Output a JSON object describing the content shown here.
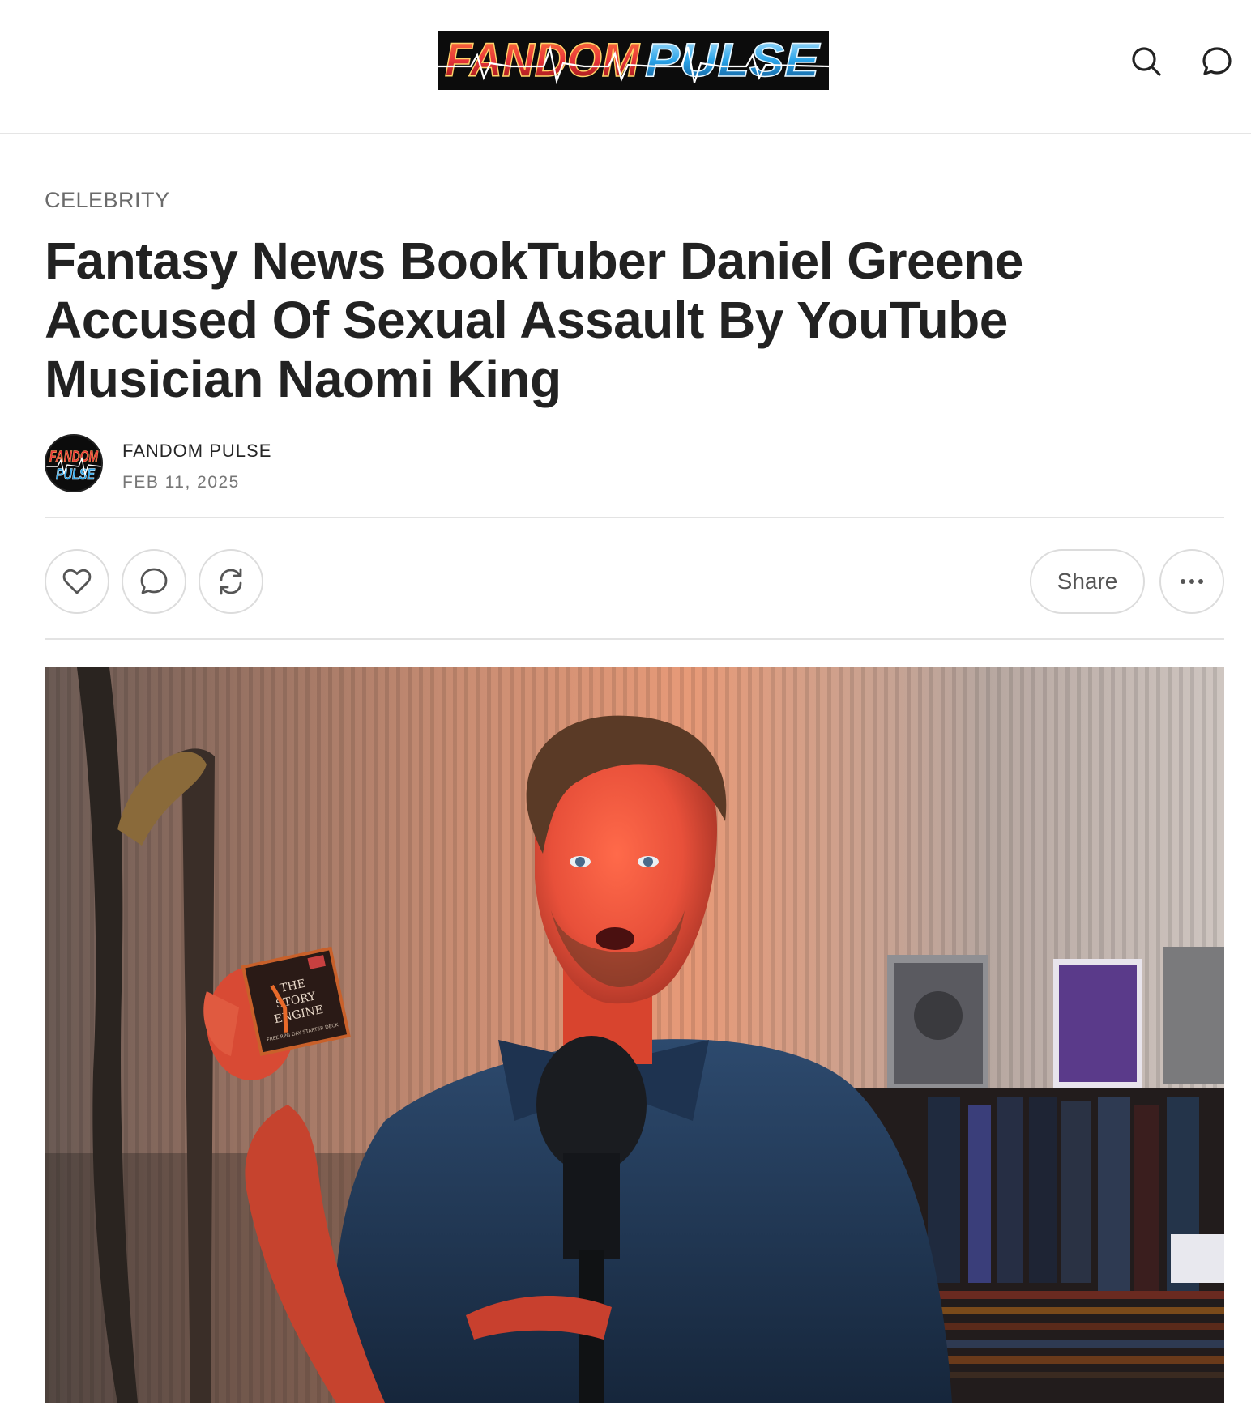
{
  "header": {
    "logo_text_left": "FANDOM",
    "logo_text_right": "PULSE",
    "search_icon": "search-icon",
    "comments_icon": "comment-icon"
  },
  "article": {
    "category": "CELEBRITY",
    "title": "Fantasy News BookTuber Daniel Greene Accused Of Sexual Assault By YouTube Musician Naomi King",
    "author": "FANDOM PULSE",
    "date": "FEB 11, 2025"
  },
  "actions": {
    "like_icon": "heart-icon",
    "comment_icon": "comment-icon",
    "restack_icon": "restack-icon",
    "share_label": "Share",
    "more_icon": "more-icon"
  },
  "hero_image": {
    "product_box_text": [
      "THE",
      "STORY",
      "ENGINE"
    ],
    "product_box_subtext": "FREE RPG DAY STARTER DECK"
  },
  "colors": {
    "logo_red": "#e8343a",
    "logo_blue": "#2aa3e8",
    "text_primary": "#222222",
    "text_muted": "#6b6b6b",
    "border": "#dcdcdc"
  }
}
